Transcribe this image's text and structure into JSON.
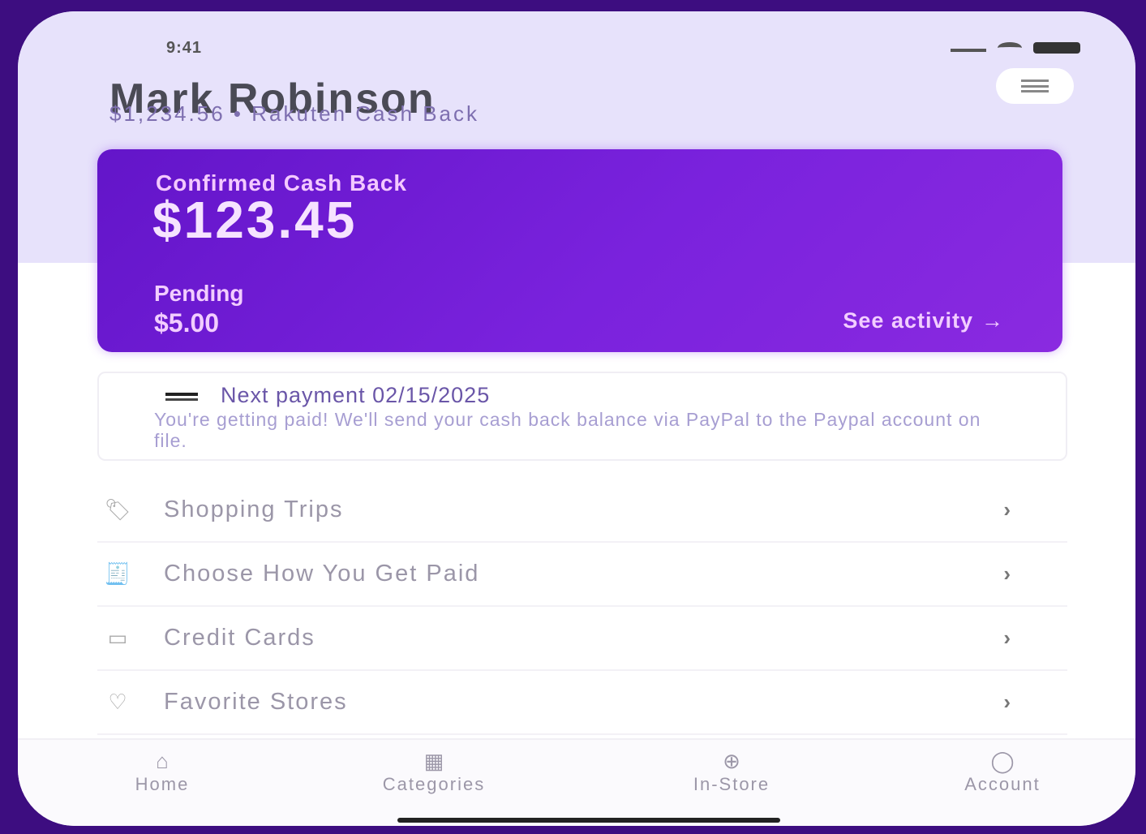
{
  "status_bar": {
    "time": "9:41"
  },
  "header": {
    "name": "Mark Robinson",
    "subtitle": "$1,234.56 • Rakuten Cash Back"
  },
  "cash_card": {
    "confirmed_label": "Confirmed Cash Back",
    "confirmed_amount": "$123.45",
    "pending_label": "Pending",
    "pending_amount": "$5.00",
    "activity_link": "See activity",
    "activity_arrow": "→"
  },
  "payment_card": {
    "icon": "card-icon",
    "title": "Next payment 02/15/2025",
    "description": "You're getting paid! We'll send your cash back balance via PayPal to the Paypal account on file."
  },
  "menu": [
    {
      "icon": "tag-icon",
      "icon_glyph": "🏷",
      "label": "Shopping Trips",
      "chevron": "›"
    },
    {
      "icon": "receipt-icon",
      "icon_glyph": "🧾",
      "label": "Choose How You Get Paid",
      "chevron": "›"
    },
    {
      "icon": "credit-card-icon",
      "icon_glyph": "▭",
      "label": "Credit Cards",
      "chevron": "›"
    },
    {
      "icon": "heart-icon",
      "icon_glyph": "♡",
      "label": "Favorite Stores",
      "chevron": "›"
    }
  ],
  "tabs": [
    {
      "icon": "home-icon",
      "icon_glyph": "⌂",
      "label": "Home"
    },
    {
      "icon": "categories-icon",
      "icon_glyph": "▦",
      "label": "Categories"
    },
    {
      "icon": "in-store-icon",
      "icon_glyph": "⊕",
      "label": "In-Store"
    },
    {
      "icon": "account-icon",
      "icon_glyph": "◯",
      "label": "Account"
    }
  ],
  "colors": {
    "background": "#3d0d80",
    "card_gradient_start": "#6315c9",
    "card_gradient_end": "#8a2ae0",
    "header_bg": "#e7e2fb"
  }
}
